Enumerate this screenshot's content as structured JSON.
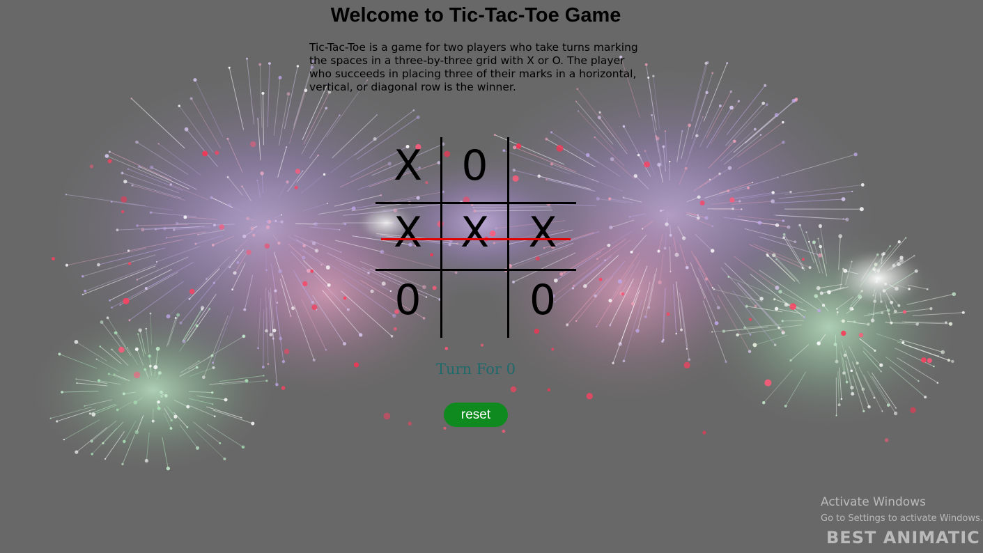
{
  "page": {
    "title": "Welcome to Tic-Tac-Toe Game",
    "description": "Tic-Tac-Toe is a game for two players who take turns marking the spaces in a three-by-three grid with X or O. The player who succeeds in placing three of their marks in a horizontal, vertical, or diagonal row is the winner."
  },
  "board": {
    "cells": [
      "X",
      "0",
      "",
      "X",
      "X",
      "X",
      "0",
      "",
      "0"
    ],
    "winning_row": "middle",
    "line_color": "#000000",
    "win_line_color": "#e00000"
  },
  "status": {
    "turn_text": "Turn For 0"
  },
  "controls": {
    "reset_label": "reset",
    "reset_color": "#0e8a1e"
  },
  "system_overlay": {
    "activate_title": "Activate Windows",
    "activate_subtitle": "Go to Settings to activate Windows.",
    "background_watermark": "BEST ANIMATIC"
  },
  "colors": {
    "accent_bar": "#0f7070",
    "turn_text": "#1e6a6a"
  },
  "background": {
    "scene": "fireworks"
  }
}
